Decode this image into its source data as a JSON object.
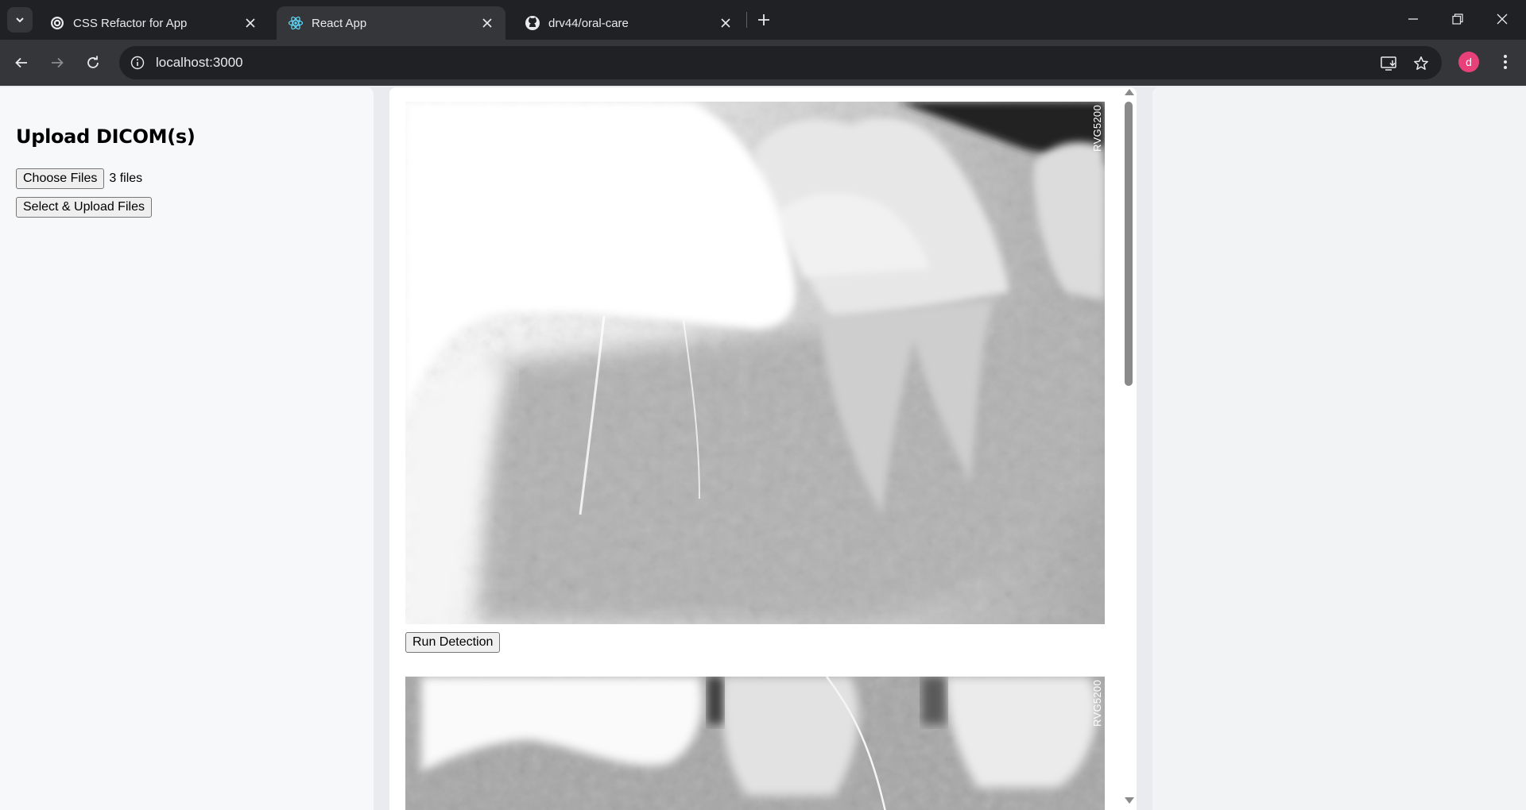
{
  "browser": {
    "tabs": [
      {
        "title": "CSS Refactor for App",
        "icon": "openai-icon",
        "active": false
      },
      {
        "title": "React App",
        "icon": "react-icon",
        "active": true
      },
      {
        "title": "drv44/oral-care",
        "icon": "github-icon",
        "active": false
      }
    ],
    "url": "localhost:3000",
    "profile_initial": "d",
    "profile_color": "#e8417a"
  },
  "sidebar": {
    "heading": "Upload DICOM(s)",
    "choose_files_label": "Choose Files",
    "file_status": "3 files",
    "upload_button_label": "Select & Upload Files"
  },
  "main": {
    "images": [
      {
        "watermark": "RVG5200",
        "description_icon": "dental-xray-image"
      },
      {
        "watermark": "RVG5200",
        "description_icon": "dental-xray-image"
      }
    ],
    "run_detection_label": "Run Detection"
  },
  "colors": {
    "page_background": "#e9ebee",
    "sidebar_background": "#f7f8fa",
    "chrome_dark": "#202124",
    "chrome_toolbar": "#35363a"
  }
}
